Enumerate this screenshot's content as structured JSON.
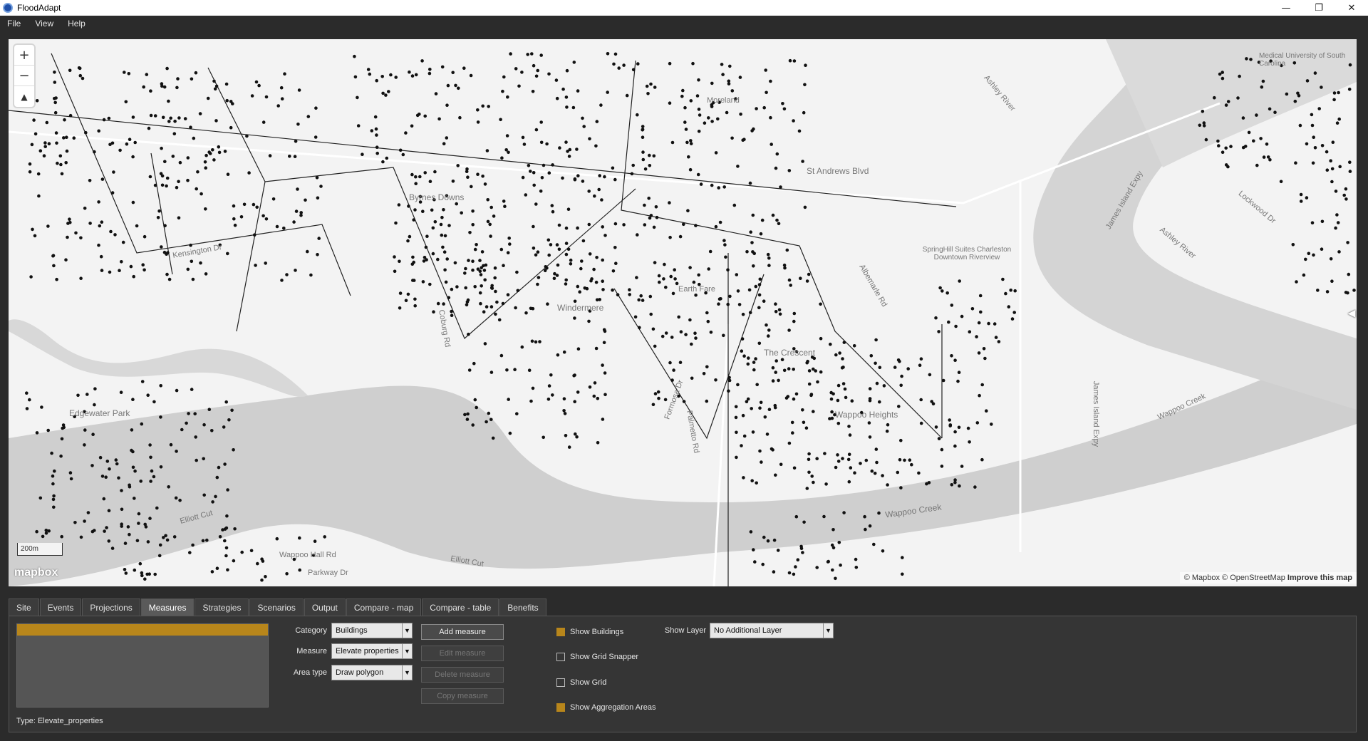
{
  "window": {
    "title": "FloodAdapt",
    "minimize": "—",
    "maximize": "❐",
    "close": "✕"
  },
  "menu": [
    "File",
    "View",
    "Help"
  ],
  "map": {
    "zoom_in": "+",
    "zoom_out": "−",
    "compass": "▲",
    "scale": "200m",
    "logo": "mapbox",
    "attribution_text": "© Mapbox © OpenStreetMap",
    "improve_link": "Improve this map",
    "collapse_arrow": "◀",
    "labels": [
      "St Andrews Blvd",
      "Byrnes Downs",
      "Moreland",
      "Earth Fare",
      "Windermere",
      "The Crescent",
      "Wappoo Heights",
      "Edgewater Park",
      "Wappoo Creek",
      "Wappoo Creek",
      "Elliott Cut",
      "Elliott Cut",
      "Ashley River",
      "Ashley River",
      "James Island Expy",
      "James Island Expy",
      "Albemarle Rd",
      "Coburg Rd",
      "Palmetto Rd",
      "Formosa Dr",
      "Kensington Dr",
      "Wappoo Hall Rd",
      "Parkway Dr",
      "Lockwood Dr",
      "Medical University of South Carolina",
      "SpringHill Suites Charleston Downtown Riverview"
    ]
  },
  "tabs": [
    "Site",
    "Events",
    "Projections",
    "Measures",
    "Strategies",
    "Scenarios",
    "Output",
    "Compare - map",
    "Compare - table",
    "Benefits"
  ],
  "active_tab": "Measures",
  "measures_panel": {
    "type_label": "Type: Elevate_properties",
    "category_label": "Category",
    "category_value": "Buildings",
    "measure_label": "Measure",
    "measure_value": "Elevate properties",
    "area_type_label": "Area type",
    "area_type_value": "Draw polygon",
    "dropdown_arrow": "▼",
    "add_measure": "Add measure",
    "edit_measure": "Edit measure",
    "delete_measure": "Delete measure",
    "copy_measure": "Copy measure",
    "show_buildings": "Show Buildings",
    "show_grid_snapper": "Show Grid Snapper",
    "show_grid": "Show Grid",
    "show_aggregation_areas": "Show Aggregation Areas",
    "show_layer_label": "Show Layer",
    "show_layer_value": "No Additional Layer",
    "checks": {
      "show_buildings": true,
      "show_grid_snapper": false,
      "show_grid": false,
      "show_aggregation_areas": true
    }
  },
  "colors": {
    "accent": "#b8861b",
    "water": "#cfcfcf",
    "land": "#f3f3f3",
    "dots": "#111111"
  }
}
